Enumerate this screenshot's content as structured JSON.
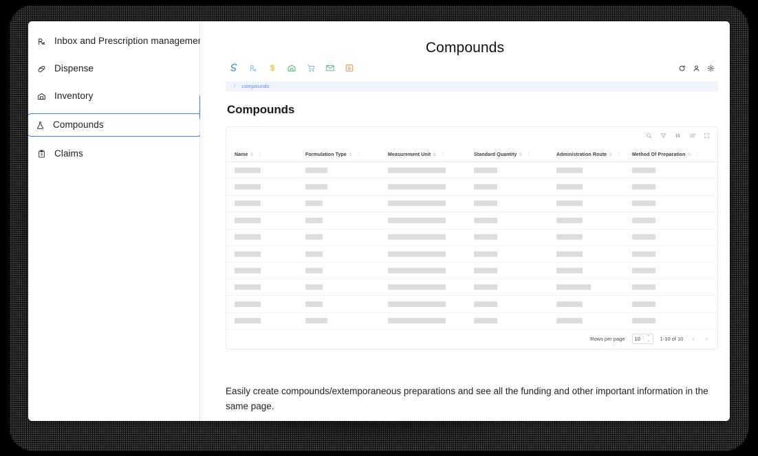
{
  "page": {
    "title": "Compounds"
  },
  "sidebar": {
    "items": [
      {
        "label": "Inbox and Prescription management",
        "icon": "rx-icon",
        "selected": false
      },
      {
        "label": "Dispense",
        "icon": "pill-icon",
        "selected": false
      },
      {
        "label": "Inventory",
        "icon": "warehouse-icon",
        "selected": false
      },
      {
        "label": "Compounds",
        "icon": "flask-icon",
        "selected": true
      },
      {
        "label": "Claims",
        "icon": "clipboard-icon",
        "selected": false
      }
    ]
  },
  "mock": {
    "toolbar_icons": [
      "brand-logo-icon",
      "rx-icon",
      "dollar-icon",
      "warehouse-icon",
      "cart-icon",
      "mail-icon",
      "card-icon"
    ],
    "toolbar_right_icons": [
      "refresh-icon",
      "account-icon",
      "settings-icon"
    ],
    "breadcrumb": {
      "separator": "/",
      "crumb": "compounds"
    },
    "section_title": "Compounds"
  },
  "grid": {
    "tool_icons": [
      "search-icon",
      "filter-icon",
      "columns-icon",
      "density-icon",
      "fullscreen-icon"
    ],
    "columns": [
      {
        "label": "Name",
        "sort": "⇅"
      },
      {
        "label": "Formulation Type",
        "sort": "⇅"
      },
      {
        "label": "Measurement Unit",
        "sort": "⇅"
      },
      {
        "label": "Standard Quantity",
        "sort": "⇅"
      },
      {
        "label": "Administration Route",
        "sort": "⇅"
      },
      {
        "label": "Method Of Preparation",
        "sort": "⇅"
      }
    ],
    "row_count": 10,
    "skeleton_widths": [
      [
        38,
        32,
        84,
        34,
        38,
        34
      ],
      [
        38,
        32,
        84,
        34,
        38,
        34
      ],
      [
        38,
        25,
        84,
        34,
        38,
        34
      ],
      [
        38,
        25,
        84,
        34,
        38,
        34
      ],
      [
        38,
        25,
        84,
        34,
        38,
        34
      ],
      [
        38,
        25,
        84,
        34,
        38,
        34
      ],
      [
        38,
        25,
        84,
        34,
        38,
        34
      ],
      [
        38,
        25,
        84,
        34,
        50,
        34
      ],
      [
        38,
        25,
        84,
        34,
        38,
        34
      ],
      [
        38,
        32,
        84,
        34,
        38,
        34
      ]
    ],
    "footer": {
      "rows_per_page_label": "Rows per page",
      "rows_per_page_value": "10",
      "range_label": "1-10 of 10",
      "prev_label": "‹",
      "next_label": "›"
    }
  },
  "caption": {
    "text": "Easily create compounds/extemporaneous preparations and see all the funding and other important information in the same page."
  },
  "colors": {
    "accent_blue": "#2f7ef0",
    "breadcrumb_bg": "#eef3fc",
    "skeleton_gray": "#dcdcdc",
    "panel_white": "#ffffff",
    "backdrop_black": "#000000"
  }
}
